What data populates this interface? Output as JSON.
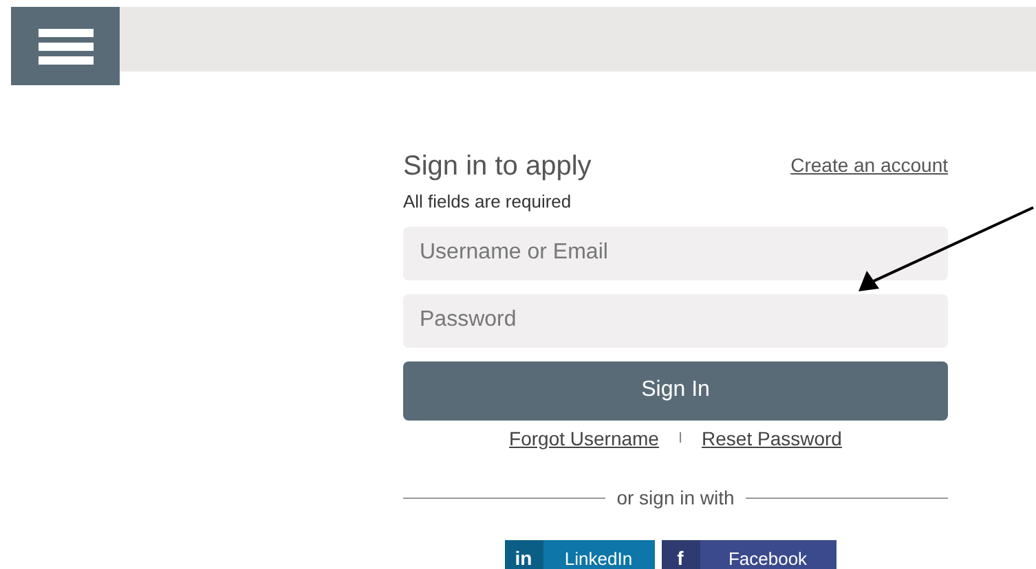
{
  "title": "Sign in to apply",
  "create_account": "Create an account",
  "required_note": "All fields are required",
  "fields": [
    {
      "placeholder": "Username or Email"
    },
    {
      "placeholder": "Password"
    }
  ],
  "sign_in_button": "Sign In",
  "links": [
    "Forgot Username",
    "Reset Password"
  ],
  "link_separator": "I",
  "divider_text": "or sign in with",
  "social": [
    {
      "kind": "linkedin",
      "icon": "in",
      "label": "LinkedIn",
      "color": "#0e76a8"
    },
    {
      "kind": "facebook",
      "icon": "f",
      "label": "Facebook",
      "color": "#3b4a8c"
    }
  ]
}
